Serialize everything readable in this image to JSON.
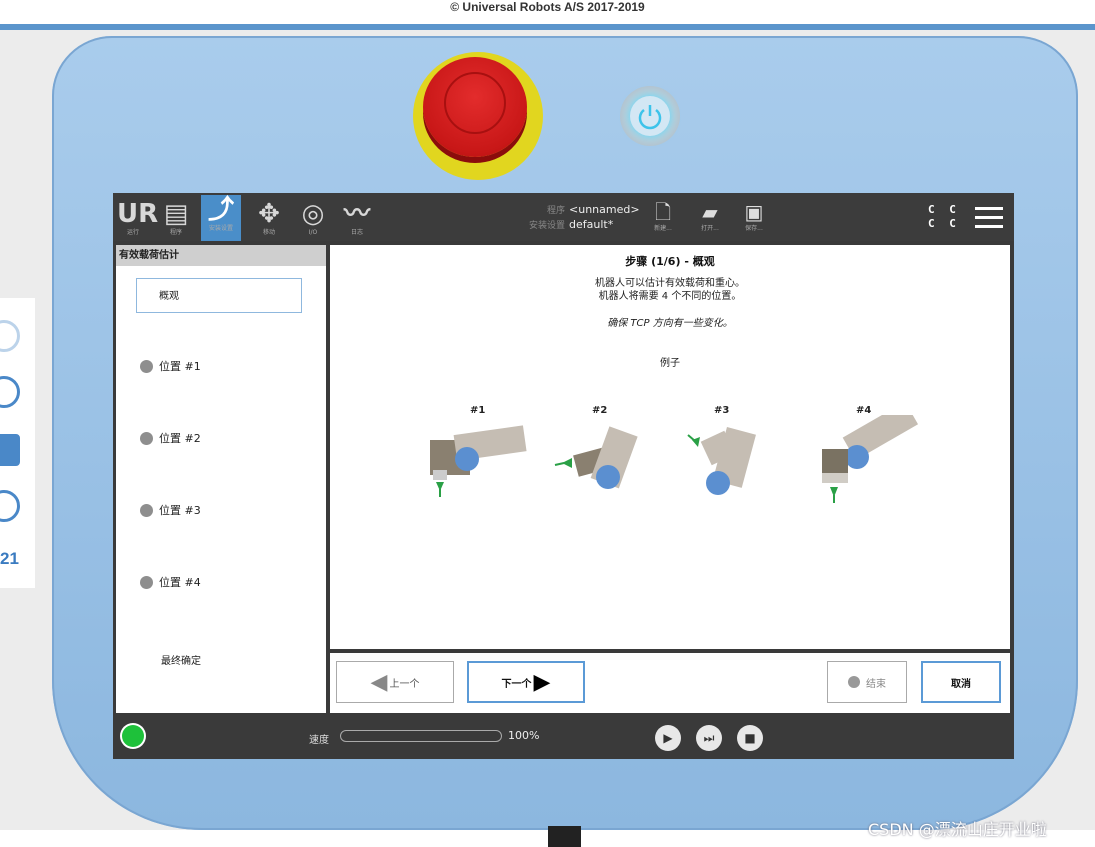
{
  "copyright": "© Universal Robots A/S 2017-2019",
  "side_number": "21",
  "header": {
    "tabs": [
      {
        "glyph": "UR",
        "label": "运行",
        "icon": "ur-logo-icon"
      },
      {
        "glyph": "▤",
        "label": "程序",
        "icon": "program-icon"
      },
      {
        "glyph": "⤴",
        "label": "安装设置",
        "icon": "installation-icon"
      },
      {
        "glyph": "✥",
        "label": "移动",
        "icon": "move-icon"
      },
      {
        "glyph": "◎",
        "label": "I/O",
        "icon": "io-icon"
      },
      {
        "glyph": "〰",
        "label": "日志",
        "icon": "log-icon"
      }
    ],
    "program_key": "程序",
    "program_value": "<unnamed>",
    "install_key": "安装设置",
    "install_value": "default*",
    "new_label": "新建...",
    "open_label": "打开...",
    "save_label": "保存...",
    "cc": "C C\nC C"
  },
  "left_panel": {
    "title": "有效载荷估计",
    "overview": "概观",
    "positions": [
      "位置 #1",
      "位置 #2",
      "位置 #3",
      "位置 #4"
    ],
    "final": "最终确定"
  },
  "main": {
    "title": "步骤 (1/6) - 概观",
    "line1": "机器人可以估计有效载荷和重心。",
    "line2": "机器人将需要 4 个不同的位置。",
    "line3": "确保 TCP 方向有一些变化。",
    "example": "例子",
    "examples": [
      "#1",
      "#2",
      "#3",
      "#4"
    ]
  },
  "nav": {
    "prev": "上一个",
    "next": "下一个",
    "finish": "结束",
    "cancel": "取消"
  },
  "footer": {
    "speed_label": "速度",
    "speed_value": "100%",
    "speed_fraction": 1.0
  },
  "watermark": "CSDN @漂流山庄开业啦",
  "colors": {
    "accent": "#4a8ec9",
    "estop": "#c81717",
    "estop_ring": "#e1d61f",
    "run_green": "#1ec13a"
  }
}
